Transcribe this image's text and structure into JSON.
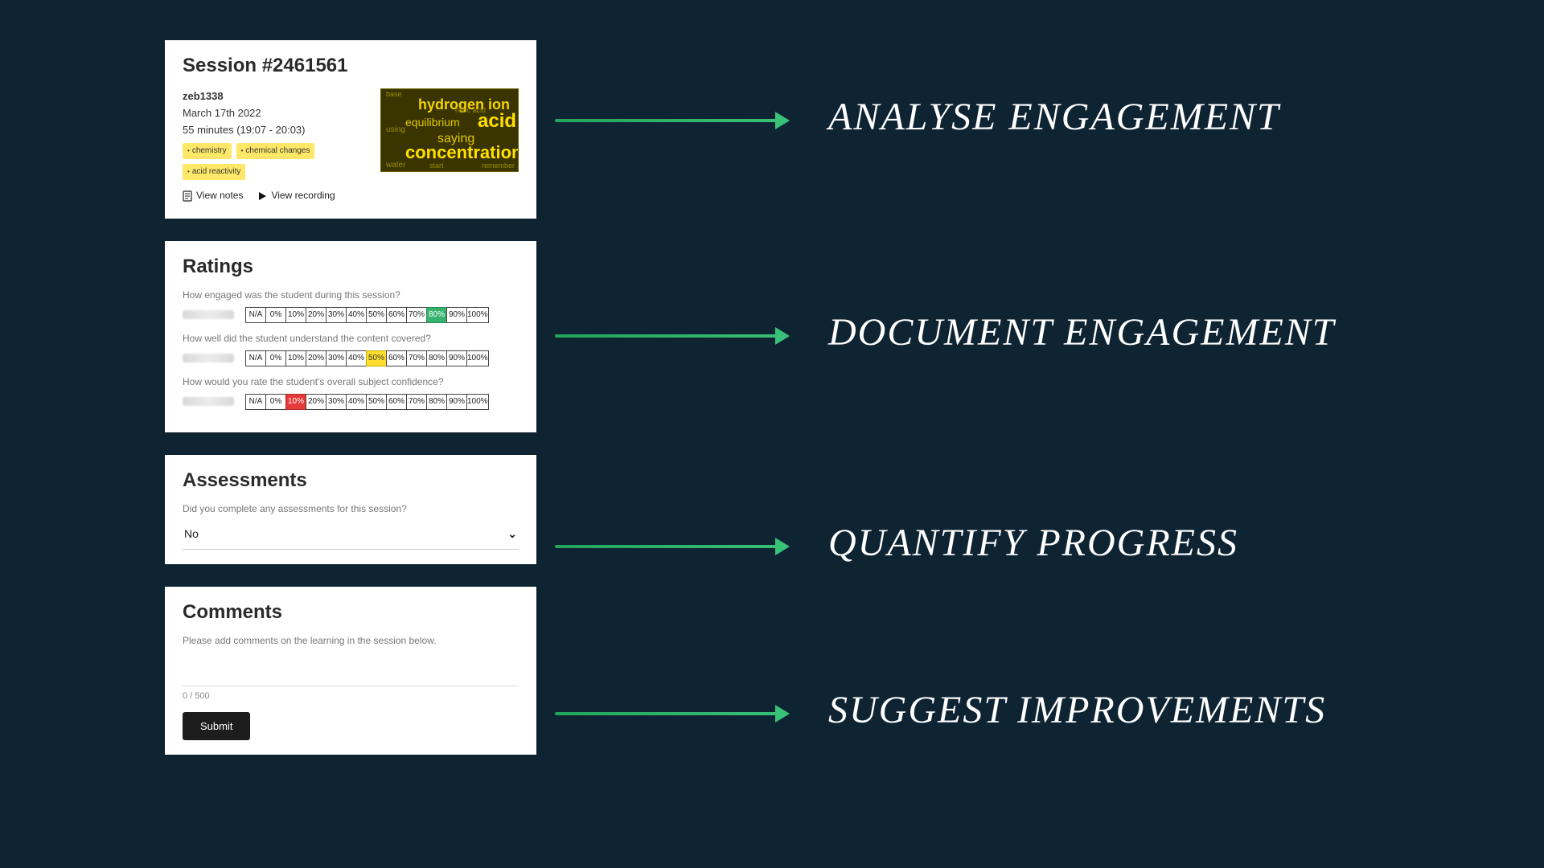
{
  "session": {
    "title": "Session #2461561",
    "username": "zeb1338",
    "date": "March 17th 2022",
    "duration": "55 minutes (19:07 - 20:03)",
    "tags": [
      "chemistry",
      "chemical changes",
      "acid reactivity"
    ],
    "view_notes": "View notes",
    "view_recording": "View recording",
    "wordcloud": {
      "hydrogen": "hydrogen ion",
      "equilibrium": "equilibrium",
      "acid": "acid",
      "saying": "saying",
      "concentration": "concentration",
      "water": "water",
      "nitric": "nitric acid",
      "using": "using",
      "base": "base",
      "remember": "remember",
      "start": "start"
    }
  },
  "ratings": {
    "title": "Ratings",
    "scale": [
      "N/A",
      "0%",
      "10%",
      "20%",
      "30%",
      "40%",
      "50%",
      "60%",
      "70%",
      "80%",
      "90%",
      "100%"
    ],
    "q1": {
      "text": "How engaged was the student during this session?",
      "selected": "80%",
      "color": "green"
    },
    "q2": {
      "text": "How well did the student understand the content covered?",
      "selected": "50%",
      "color": "yellow"
    },
    "q3": {
      "text": "How would you rate the student's overall subject confidence?",
      "selected": "10%",
      "color": "red"
    }
  },
  "assessments": {
    "title": "Assessments",
    "question": "Did you complete any assessments for this session?",
    "value": "No"
  },
  "comments": {
    "title": "Comments",
    "prompt": "Please add comments on the learning in the session below.",
    "counter": "0 / 500",
    "submit": "Submit"
  },
  "callouts": {
    "c1": "ANALYSE ENGAGEMENT",
    "c2": "DOCUMENT ENGAGEMENT",
    "c3": "QUANTIFY PROGRESS",
    "c4": "SUGGEST IMPROVEMENTS"
  }
}
